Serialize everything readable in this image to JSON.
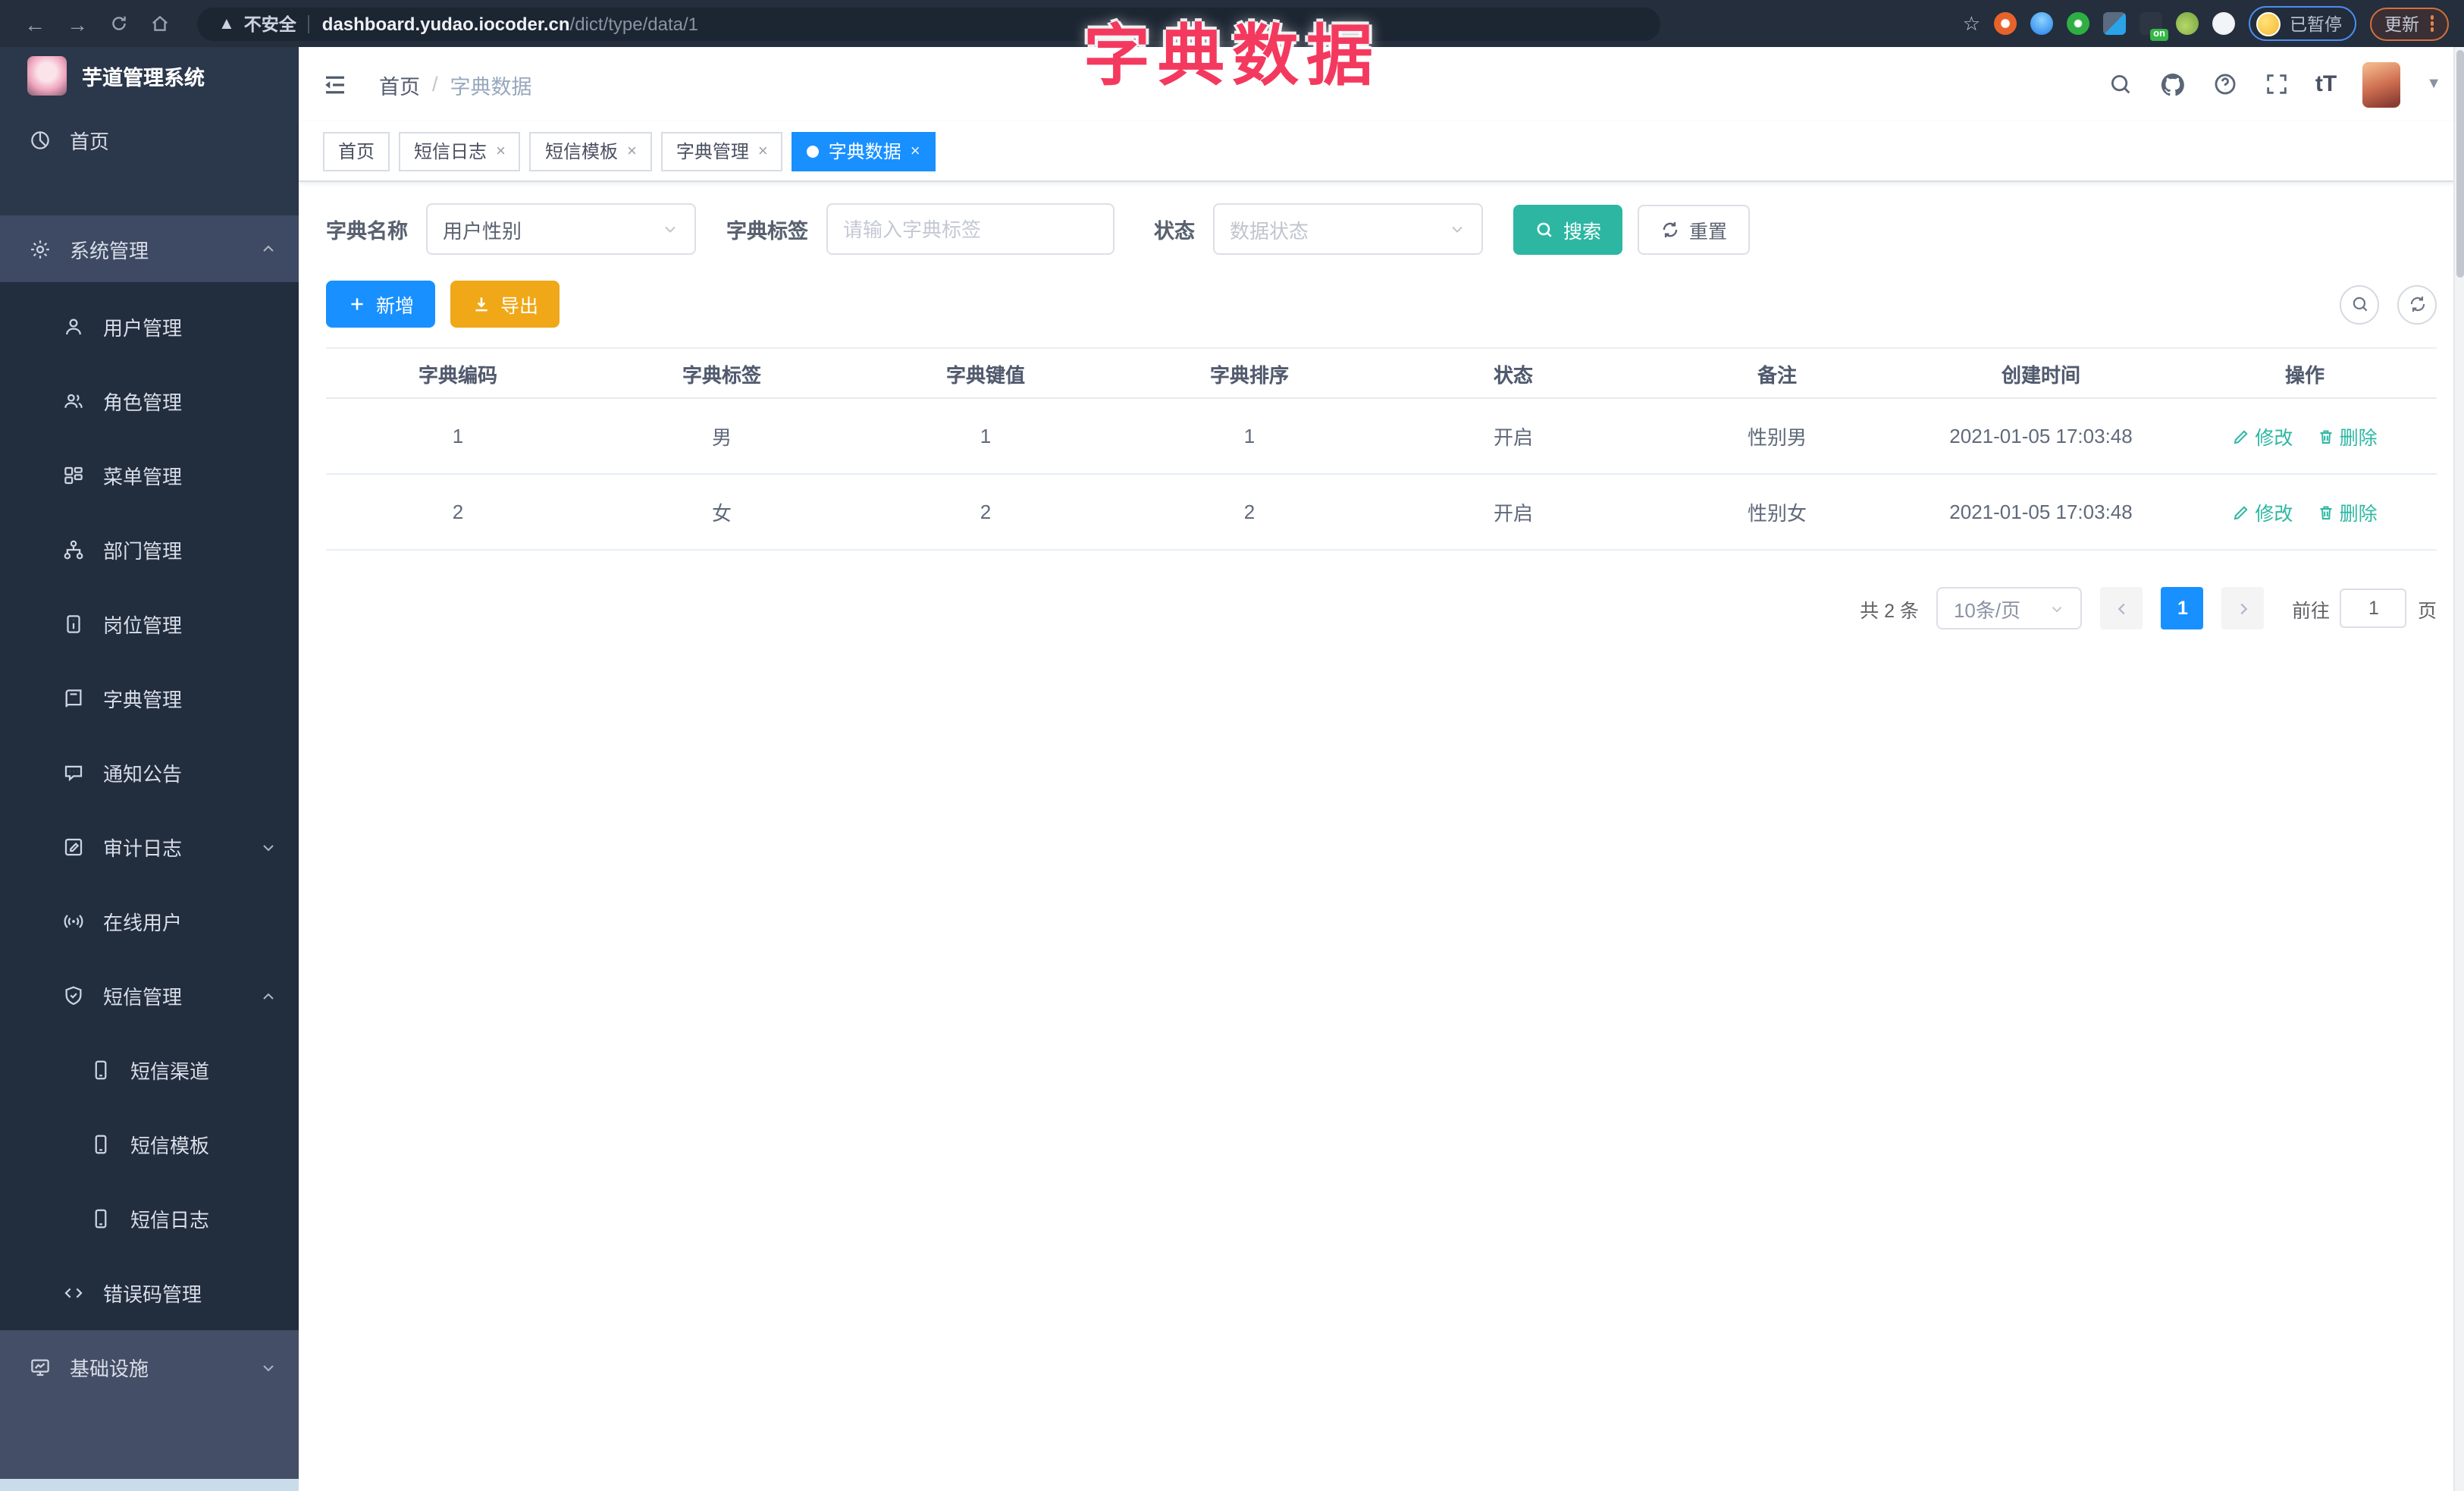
{
  "colors": {
    "primary": "#1890ff",
    "teal": "#2db7a3",
    "warning": "#f0a818",
    "title_pink": "#f4395f",
    "sidebar_bg": "#2b374a",
    "submenu_bg": "#222d3e"
  },
  "browser": {
    "security_warning": "不安全",
    "url_domain": "dashboard.yudao.iocoder.cn",
    "url_path": "/dict/type/data/1",
    "extension_on_badge": "on",
    "paused_badge": "已暂停",
    "update_button": "更新"
  },
  "overlay_title": "字典数据",
  "sidebar": {
    "logo_title": "芋道管理系统",
    "items": [
      {
        "label": "首页"
      },
      {
        "label": "系统管理"
      },
      {
        "label": "用户管理"
      },
      {
        "label": "角色管理"
      },
      {
        "label": "菜单管理"
      },
      {
        "label": "部门管理"
      },
      {
        "label": "岗位管理"
      },
      {
        "label": "字典管理"
      },
      {
        "label": "通知公告"
      },
      {
        "label": "审计日志"
      },
      {
        "label": "在线用户"
      },
      {
        "label": "短信管理"
      },
      {
        "label": "短信渠道"
      },
      {
        "label": "短信模板"
      },
      {
        "label": "短信日志"
      },
      {
        "label": "错误码管理"
      },
      {
        "label": "基础设施"
      }
    ]
  },
  "header": {
    "breadcrumb_home": "首页",
    "breadcrumb_separator": "/",
    "breadcrumb_current": "字典数据",
    "font_size_icon": "tT"
  },
  "tabs": [
    {
      "label": "首页"
    },
    {
      "label": "短信日志"
    },
    {
      "label": "短信模板"
    },
    {
      "label": "字典管理"
    },
    {
      "label": "字典数据"
    }
  ],
  "filters": {
    "dict_name_label": "字典名称",
    "dict_name_value": "用户性别",
    "dict_label_label": "字典标签",
    "dict_label_placeholder": "请输入字典标签",
    "status_label": "状态",
    "status_placeholder": "数据状态",
    "search_button": "搜索",
    "reset_button": "重置"
  },
  "toolbar": {
    "add_button": "新增",
    "export_button": "导出"
  },
  "table": {
    "columns": [
      "字典编码",
      "字典标签",
      "字典键值",
      "字典排序",
      "状态",
      "备注",
      "创建时间",
      "操作"
    ],
    "rows": [
      {
        "code": "1",
        "label": "男",
        "value": "1",
        "sort": "1",
        "status": "开启",
        "remark": "性别男",
        "created": "2021-01-05 17:03:48"
      },
      {
        "code": "2",
        "label": "女",
        "value": "2",
        "sort": "2",
        "status": "开启",
        "remark": "性别女",
        "created": "2021-01-05 17:03:48"
      }
    ],
    "edit_label": "修改",
    "delete_label": "删除"
  },
  "pagination": {
    "total": "共 2 条",
    "page_size": "10条/页",
    "current_page": "1",
    "goto_label": "前往",
    "goto_value": "1",
    "page_unit": "页"
  }
}
